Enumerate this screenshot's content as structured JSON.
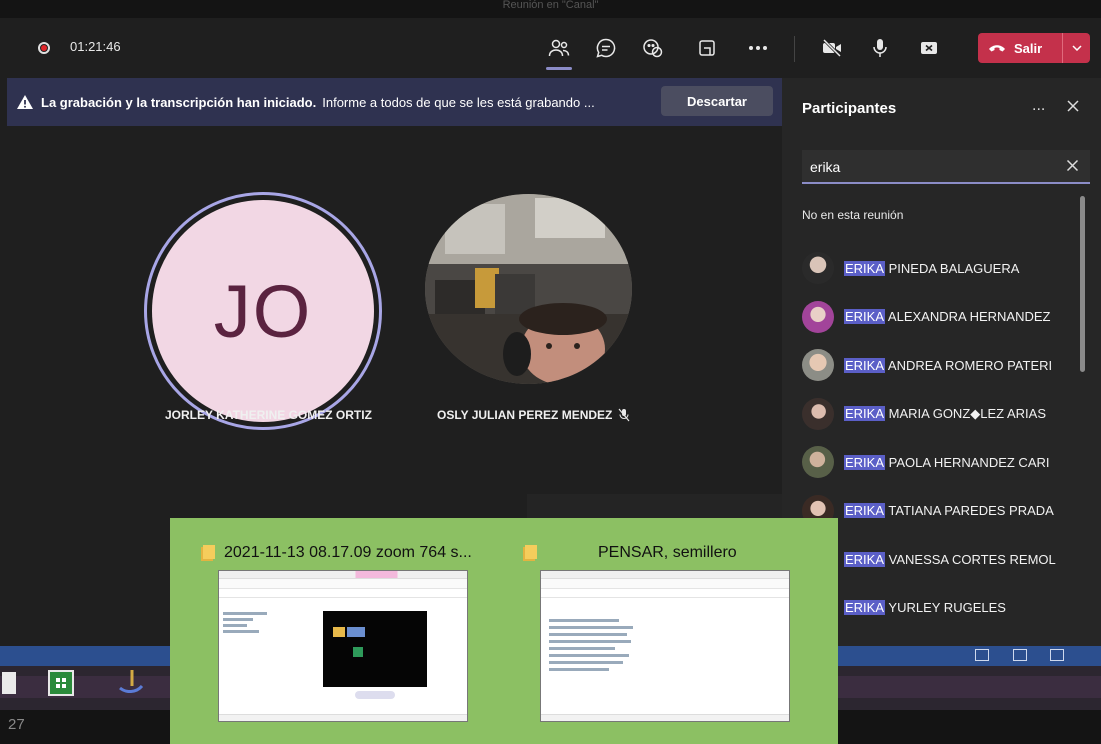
{
  "window": {
    "title": "Reunión en \"Canal\""
  },
  "toolbar": {
    "recording_time": "01:21:46",
    "buttons": [
      {
        "name": "participants-button",
        "icon": "people-icon",
        "active": true
      },
      {
        "name": "chat-button",
        "icon": "chat-icon"
      },
      {
        "name": "reactions-button",
        "icon": "raise-hand-icon"
      },
      {
        "name": "rooms-button",
        "icon": "share-tray-icon"
      },
      {
        "name": "more-actions-button",
        "icon": "more-icon"
      },
      {
        "name": "camera-button",
        "icon": "camera-off-icon"
      },
      {
        "name": "mic-button",
        "icon": "mic-icon"
      },
      {
        "name": "share-button",
        "icon": "share-screen-icon"
      }
    ],
    "leave_label": "Salir",
    "leave_color": "#c4314b"
  },
  "banner": {
    "bold_text": "La grabación y la transcripción han iniciado.",
    "text": "Informe a todos de que se les está grabando ...",
    "dismiss_label": "Descartar"
  },
  "stage": {
    "tiles": [
      {
        "initials": "JO",
        "name": "JORLEY KATHERINE GOMEZ ORTIZ",
        "muted": false
      },
      {
        "initials": "",
        "name": "OSLY JULIAN PEREZ MENDEZ",
        "muted": true
      }
    ]
  },
  "participants_panel": {
    "title": "Participantes",
    "more_label": "...",
    "search_value": "erika",
    "section_label": "No en esta reunión",
    "highlight_color": "#5b5fc7",
    "people": [
      {
        "highlight": "ERIKA",
        "rest": "PINEDA BALAGUERA"
      },
      {
        "highlight": "ERIKA",
        "rest": "ALEXANDRA HERNANDEZ"
      },
      {
        "highlight": "ERIKA",
        "rest": "ANDREA ROMERO PATERI"
      },
      {
        "highlight": "ERIKA",
        "rest": "MARIA GONZ◆LEZ ARIAS"
      },
      {
        "highlight": "ERIKA",
        "rest": "PAOLA HERNANDEZ CARI"
      },
      {
        "highlight": "ERIKA",
        "rest": "TATIANA PAREDES PRADA"
      },
      {
        "highlight": "ERIKA",
        "rest": "VANESSA CORTES REMOL"
      },
      {
        "highlight": "ERIKA",
        "rest": "YURLEY RUGELES"
      }
    ]
  },
  "taskbar": {
    "clock_fragment": "27"
  },
  "explorer_preview": {
    "windows": [
      {
        "title": "2021-11-13 08.17.09 zoom 764 s...",
        "icon": "folder-icon"
      },
      {
        "title": "PENSAR, semillero",
        "icon": "folder-icon"
      }
    ]
  }
}
